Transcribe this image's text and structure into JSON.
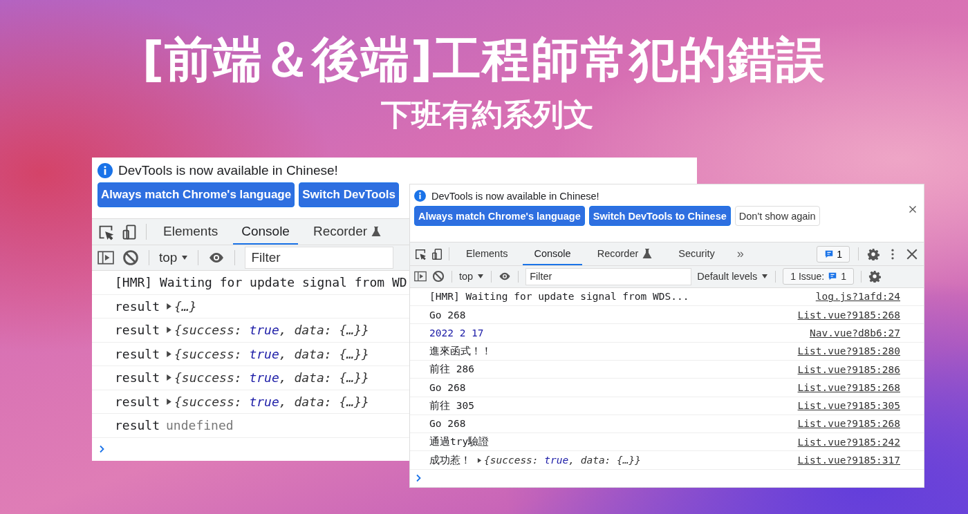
{
  "banner": {
    "title": "[前端＆後端]工程師常犯的錯誤",
    "subtitle": "下班有約系列文"
  },
  "back_devtools": {
    "infobar": {
      "message": "DevTools is now available in Chinese!"
    },
    "buttons": [
      {
        "label": "Always match Chrome's language",
        "kind": "primary"
      },
      {
        "label": "Switch DevTools",
        "kind": "primary"
      }
    ],
    "tabs": [
      {
        "label": "Elements",
        "selected": false
      },
      {
        "label": "Console",
        "selected": true
      },
      {
        "label": "Recorder",
        "selected": false,
        "experimental": true
      }
    ],
    "toolbar": {
      "context": "top",
      "filter_placeholder": "Filter"
    },
    "messages": [
      {
        "parts": [
          {
            "kind": "plain",
            "text": "[HMR] Waiting for update signal from WD"
          }
        ]
      },
      {
        "parts": [
          {
            "kind": "plain",
            "text": "result"
          },
          {
            "kind": "object",
            "text": "{…}"
          }
        ]
      },
      {
        "parts": [
          {
            "kind": "plain",
            "text": "result"
          },
          {
            "kind": "object",
            "text": "{success: true, data: {…}}"
          }
        ]
      },
      {
        "parts": [
          {
            "kind": "plain",
            "text": "result"
          },
          {
            "kind": "object",
            "text": "{success: true, data: {…}}"
          }
        ]
      },
      {
        "parts": [
          {
            "kind": "plain",
            "text": "result"
          },
          {
            "kind": "object",
            "text": "{success: true, data: {…}}"
          }
        ]
      },
      {
        "parts": [
          {
            "kind": "plain",
            "text": "result"
          },
          {
            "kind": "object",
            "text": "{success: true, data: {…}}"
          }
        ]
      },
      {
        "parts": [
          {
            "kind": "plain",
            "text": "result"
          },
          {
            "kind": "undefined",
            "text": "undefined"
          }
        ]
      }
    ]
  },
  "front_devtools": {
    "infobar": {
      "message": "DevTools is now available in Chinese!"
    },
    "buttons": [
      {
        "label": "Always match Chrome's language",
        "kind": "primary"
      },
      {
        "label": "Switch DevTools to Chinese",
        "kind": "primary"
      },
      {
        "label": "Don't show again",
        "kind": "secondary"
      }
    ],
    "tabs": [
      {
        "label": "Elements",
        "selected": false
      },
      {
        "label": "Console",
        "selected": true
      },
      {
        "label": "Recorder",
        "selected": false,
        "experimental": true
      },
      {
        "label": "Security",
        "selected": false
      }
    ],
    "more_tabs": "»",
    "message_count": "1",
    "toolbar": {
      "context": "top",
      "filter_placeholder": "Filter",
      "levels": "Default levels",
      "issues_label": "1 Issue:",
      "issues_count": "1"
    },
    "messages": [
      {
        "parts": [
          {
            "kind": "plain",
            "text": "[HMR] Waiting for update signal from WDS..."
          }
        ],
        "source": "log.js?1afd:24"
      },
      {
        "parts": [
          {
            "kind": "plain",
            "text": "Go 268"
          }
        ],
        "source": "List.vue?9185:268"
      },
      {
        "parts": [
          {
            "kind": "number",
            "text": "2022 2 17"
          }
        ],
        "source": "Nav.vue?d8b6:27"
      },
      {
        "parts": [
          {
            "kind": "plain",
            "text": "進來函式！！"
          }
        ],
        "source": "List.vue?9185:280"
      },
      {
        "parts": [
          {
            "kind": "plain",
            "text": "前往 286"
          }
        ],
        "source": "List.vue?9185:286"
      },
      {
        "parts": [
          {
            "kind": "plain",
            "text": "Go 268"
          }
        ],
        "source": "List.vue?9185:268"
      },
      {
        "parts": [
          {
            "kind": "plain",
            "text": "前往 305"
          }
        ],
        "source": "List.vue?9185:305"
      },
      {
        "parts": [
          {
            "kind": "plain",
            "text": "Go 268"
          }
        ],
        "source": "List.vue?9185:268"
      },
      {
        "parts": [
          {
            "kind": "plain",
            "text": "通過try驗證"
          }
        ],
        "source": "List.vue?9185:242"
      },
      {
        "parts": [
          {
            "kind": "plain",
            "text": "成功惹！"
          },
          {
            "kind": "object",
            "text": "{success: true, data: {…}}"
          }
        ],
        "source": "List.vue?9185:317"
      }
    ]
  }
}
